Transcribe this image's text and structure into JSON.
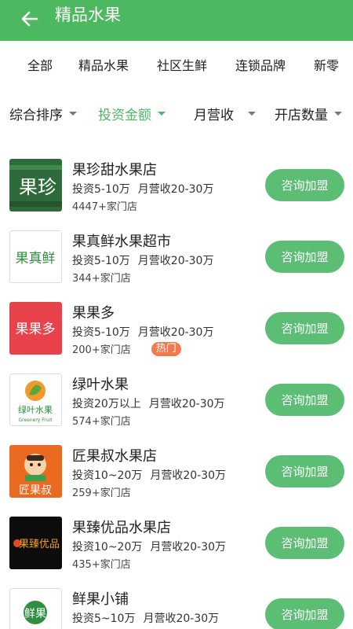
{
  "header": {
    "title": "精品水果",
    "back_icon": "arrow-left-icon",
    "background": "#4cb860"
  },
  "category_tabs": [
    "全部",
    "精品水果",
    "社区生鲜",
    "连锁品牌",
    "新零"
  ],
  "filters": [
    {
      "label": "综合排序",
      "active": false
    },
    {
      "label": "投资金额",
      "active": true
    },
    {
      "label": "月营收",
      "active": false
    },
    {
      "label": "开店数量",
      "active": false
    }
  ],
  "accent_color": "#4cb860",
  "button_color": "#5cbd74",
  "hot_color": "#f2794e",
  "items": [
    {
      "name": "果珍甜水果店",
      "invest": "投资5-10万",
      "revenue": "月营收20-30万",
      "stores": "4447+家门店",
      "badge": "",
      "button": "咨询加盟",
      "logo_text": "果珍"
    },
    {
      "name": "果真鲜水果超市",
      "invest": "投资5-10万",
      "revenue": "月营收20-30万",
      "stores": "344+家门店",
      "badge": "",
      "button": "咨询加盟",
      "logo_text": "果真鲜"
    },
    {
      "name": "果果多",
      "invest": "投资5-10万",
      "revenue": "月营收20-30万",
      "stores": "200+家门店",
      "badge": "热门",
      "button": "咨询加盟",
      "logo_text": "果果多"
    },
    {
      "name": "绿叶水果",
      "invest": "投资20万以上",
      "revenue": "月营收20-30万",
      "stores": "574+家门店",
      "badge": "",
      "button": "咨询加盟",
      "logo_text": "绿叶水果",
      "logo_subtext": "Greenery Fruit"
    },
    {
      "name": "匠果叔水果店",
      "invest": "投资10~20万",
      "revenue": "月营收20-30万",
      "stores": "259+家门店",
      "badge": "",
      "button": "咨询加盟",
      "logo_text": "匠果叔"
    },
    {
      "name": "果臻优品水果店",
      "invest": "投资10~20万",
      "revenue": "月营收20-30万",
      "stores": "435+家门店",
      "badge": "",
      "button": "咨询加盟",
      "logo_text": "果臻优品"
    },
    {
      "name": "鲜果小铺",
      "invest": "投资5~10万",
      "revenue": "月营收20-30万",
      "stores": "",
      "badge": "",
      "button": "咨询加盟",
      "logo_text": "鲜果"
    }
  ]
}
